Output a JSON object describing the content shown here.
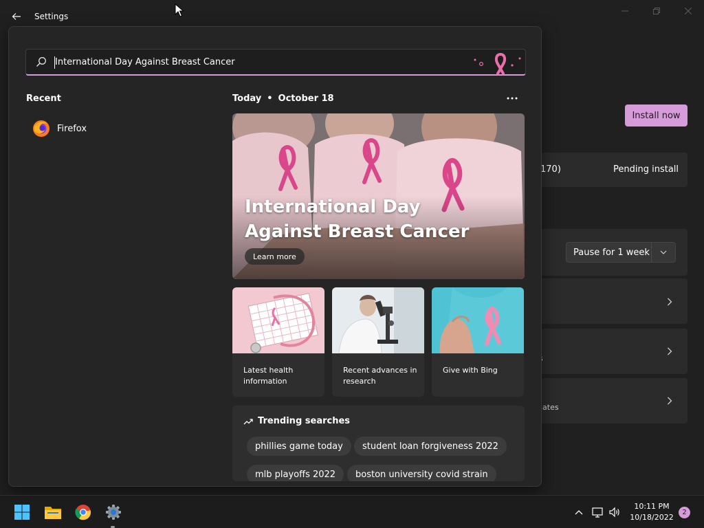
{
  "window": {
    "title": "Settings",
    "install_label": "Install now",
    "cards": [
      {
        "text": "170)",
        "status": "Pending install"
      },
      {
        "select_value": "Pause for 1 week"
      },
      {
        "sub": ""
      },
      {
        "sub": "s"
      },
      {
        "sub": "lates"
      }
    ]
  },
  "search": {
    "query": "International Day Against Breast Cancer"
  },
  "recent": {
    "heading": "Recent",
    "items": [
      {
        "label": "Firefox",
        "icon": "firefox-icon"
      }
    ]
  },
  "today": {
    "label": "Today",
    "date": "October 18",
    "more": "...",
    "hero_title": "International Day Against Breast Cancer",
    "learn_more": "Learn more",
    "tiles": [
      {
        "caption": "Latest health information"
      },
      {
        "caption": "Recent advances in research"
      },
      {
        "caption": "Give with Bing"
      }
    ]
  },
  "trending": {
    "heading": "Trending searches",
    "chips": [
      "phillies game today",
      "student loan forgiveness 2022",
      "mlb playoffs 2022",
      "boston university covid strain"
    ]
  },
  "taskbar": {
    "time": "10:11 PM",
    "date": "10/18/2022",
    "notifications": "2"
  },
  "colors": {
    "accent": "#d69bd9",
    "ribbon": "#e86fa8",
    "background": "#202020"
  }
}
